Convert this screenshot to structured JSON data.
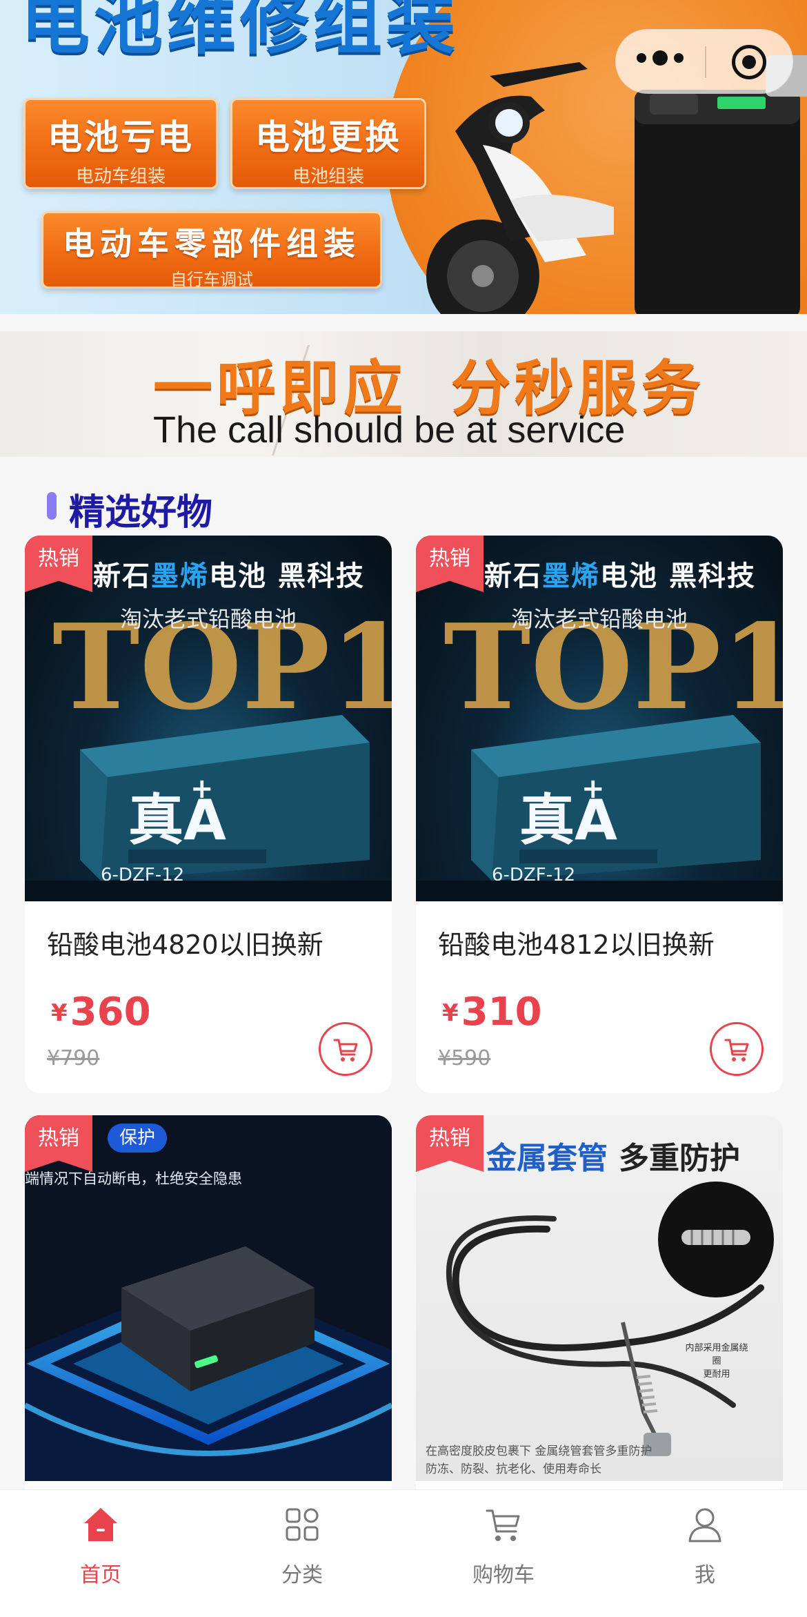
{
  "hero": {
    "title": "电池维修组装",
    "services": [
      {
        "label": "电池亏电",
        "sub": "电动车组装"
      },
      {
        "label": "电池更换",
        "sub": "电池组装"
      },
      {
        "label": "电动车零部件组装",
        "sub": "自行车调试"
      }
    ]
  },
  "slogan": {
    "zh_left": "一呼即应",
    "zh_right": "分秒服务",
    "en": "The call should be at service"
  },
  "section": {
    "title": "精选好物"
  },
  "products": [
    {
      "badge": "热销",
      "name": "铅酸电池4820以旧换新",
      "price": "360",
      "original_price": "¥790",
      "image": {
        "headline_prefix": "新石",
        "headline_highlight": "墨烯",
        "headline_suffix": "电池 黑科技",
        "subline": "淘汰老式铅酸电池",
        "brand_text": "TOP1",
        "battery_label": "真A",
        "battery_model": "6-DZF-12"
      }
    },
    {
      "badge": "热销",
      "name": "铅酸电池4812以旧换新",
      "price": "310",
      "original_price": "¥590",
      "image": {
        "headline_prefix": "新石",
        "headline_highlight": "墨烯",
        "headline_suffix": "电池 黑科技",
        "subline": "淘汰老式铅酸电池",
        "brand_text": "TOP1",
        "battery_label": "真A",
        "battery_model": "6-DZF-12"
      }
    },
    {
      "badge": "热销",
      "image": {
        "tag": "保护",
        "caption": "端情况下自动断电，杜绝安全隐患"
      }
    },
    {
      "badge": "热销",
      "image": {
        "headline_highlight": "金属套管",
        "headline_suffix": "多重防护",
        "inset_caption_1": "内部采用金属绕圈",
        "inset_caption_2": "更耐用",
        "footer_1": "在高密度胶皮包裹下 金属绕管套管多重防护",
        "footer_2": "防冻、防裂、抗老化、使用寿命长"
      }
    }
  ],
  "price_currency": "¥",
  "tabbar": [
    {
      "label": "首页",
      "icon": "home-icon",
      "active": true
    },
    {
      "label": "分类",
      "icon": "category-grid-icon",
      "active": false
    },
    {
      "label": "购物车",
      "icon": "shopping-cart-icon",
      "active": false
    },
    {
      "label": "我",
      "icon": "user-profile-icon",
      "active": false
    }
  ],
  "colors": {
    "accent": "#e8434d",
    "section_title": "#1f1aa6",
    "banner_orange": "#f07a1a",
    "banner_blue": "#1676d6"
  }
}
